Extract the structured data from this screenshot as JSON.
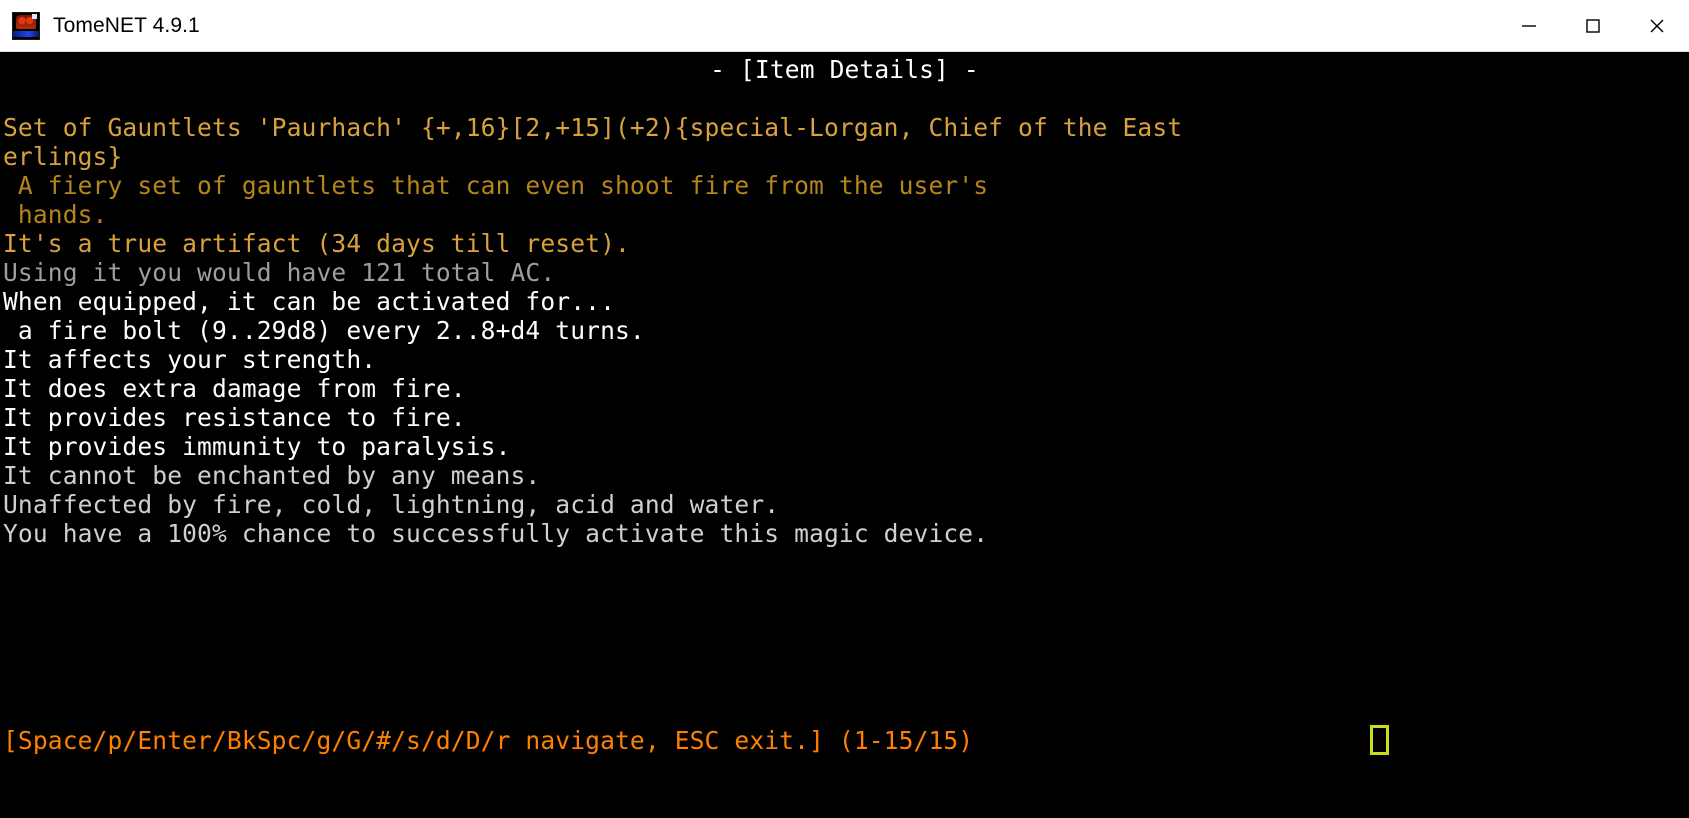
{
  "window": {
    "title": "TomeNET 4.9.1",
    "icon": "tomenet-skull-icon",
    "controls": {
      "minimize": "minimize-icon",
      "maximize": "maximize-icon",
      "close": "close-icon"
    }
  },
  "colors": {
    "title_bar_bg": "#ffffff",
    "title_bar_fg": "#000000",
    "terminal_bg": "#000000",
    "white": "#ffffff",
    "light_gray": "#cfcfcf",
    "gray": "#9e9e9e",
    "gold": "#d8a13c",
    "olive": "#b4851c",
    "orange": "#ff8000",
    "cursor": "#c8dd18"
  },
  "terminal": {
    "heading": "- [Item Details] -",
    "lines": [
      {
        "text": "Set of Gauntlets 'Paurhach' {+,16}[2,+15](+2){special-Lorgan, Chief of the East",
        "color": "gold"
      },
      {
        "text": "erlings}",
        "color": "gold"
      },
      {
        "text": " A fiery set of gauntlets that can even shoot fire from the user's",
        "color": "olive"
      },
      {
        "text": " hands.",
        "color": "olive"
      },
      {
        "text": "It's a true artifact (34 days till reset).",
        "color": "gold"
      },
      {
        "text": "Using it you would have 121 total AC.",
        "color": "gray"
      },
      {
        "text": "When equipped, it can be activated for...",
        "color": "white"
      },
      {
        "text": " a fire bolt (9..29d8) every 2..8+d4 turns.",
        "color": "white"
      },
      {
        "text": "It affects your strength.",
        "color": "white"
      },
      {
        "text": "It does extra damage from fire.",
        "color": "white"
      },
      {
        "text": "It provides resistance to fire.",
        "color": "white"
      },
      {
        "text": "It provides immunity to paralysis.",
        "color": "white"
      },
      {
        "text": "It cannot be enchanted by any means.",
        "color": "light_gray"
      },
      {
        "text": "Unaffected by fire, cold, lightning, acid and water.",
        "color": "light_gray"
      },
      {
        "text": "You have a 100% chance to successfully activate this magic device.",
        "color": "light_gray"
      }
    ],
    "status_bar": {
      "text": "[Space/p/Enter/BkSpc/g/G/#/s/d/D/r navigate, ESC exit.] (1-15/15)",
      "color": "orange",
      "cursor": "block-cursor"
    }
  }
}
